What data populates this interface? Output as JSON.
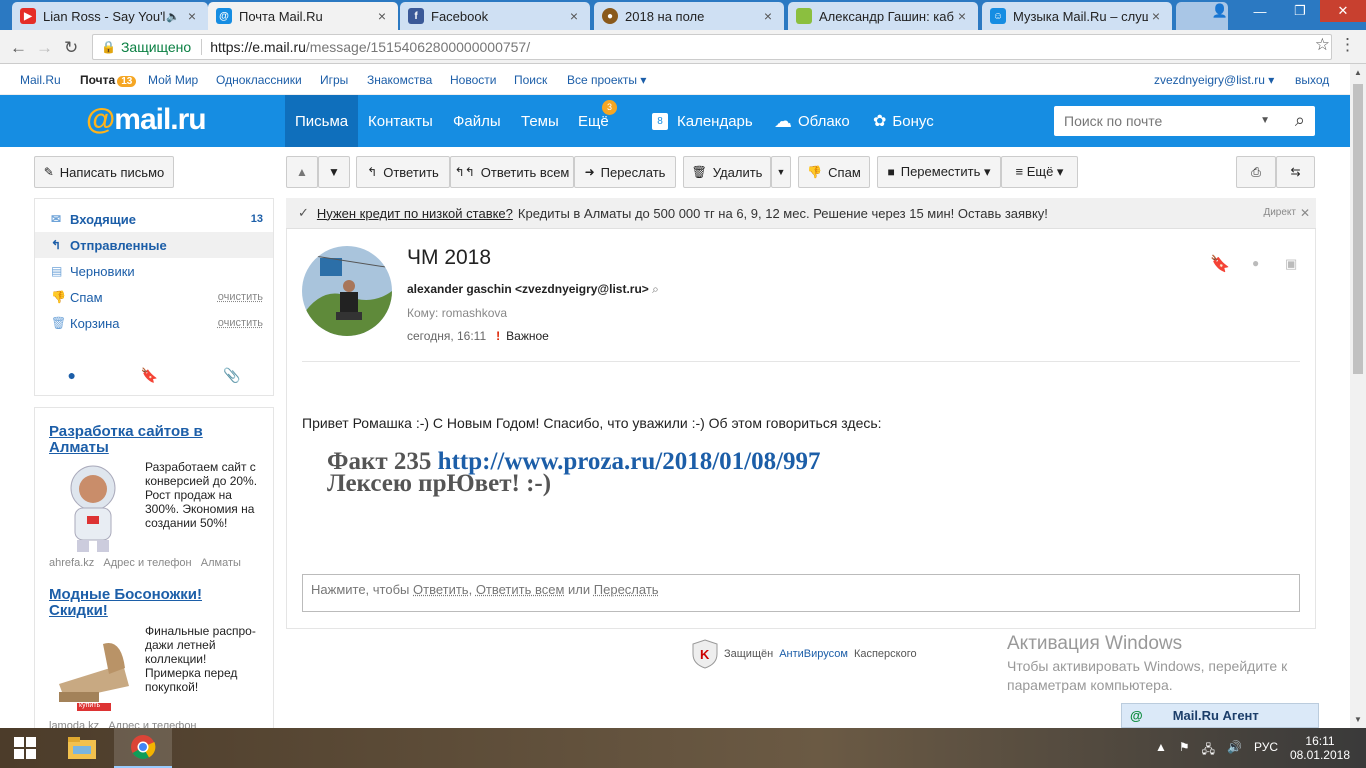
{
  "browser": {
    "tabs": [
      {
        "title": "Lian Ross - Say You'll",
        "color": "#e52d27",
        "icon": "youtube-icon"
      },
      {
        "title": "Почта Mail.Ru",
        "color": "#168de2",
        "icon": "mailru-icon"
      },
      {
        "title": "Facebook",
        "color": "#3b5998",
        "icon": "facebook-icon"
      },
      {
        "title": "2018 на поле",
        "color": "#8a5a1c",
        "icon": "ball-icon"
      },
      {
        "title": "Александр Гашин: каби",
        "color": "#8bbf3f",
        "icon": "page-icon"
      },
      {
        "title": "Музыка Mail.Ru – слуша",
        "color": "#168de2",
        "icon": "music-icon"
      }
    ],
    "secure_label": "Защищено",
    "url_host": "https://e.mail.ru",
    "url_path": "/message/15154062800000000757/"
  },
  "portal": {
    "links": [
      "Mail.Ru",
      "Почта",
      "Мой Мир",
      "Одноклассники",
      "Игры",
      "Знакомства",
      "Новости",
      "Поиск",
      "Все проекты ▾"
    ],
    "mail_count": "13",
    "user": "zvezdnyeigry@list.ru ▾",
    "logout": "выход"
  },
  "header": {
    "logo_at": "@",
    "logo_text": "mail.ru",
    "nav": [
      "Письма",
      "Контакты",
      "Файлы",
      "Темы",
      "Ещё"
    ],
    "more_badge": "3",
    "extra": [
      "Календарь",
      "Облако",
      "Бонус"
    ],
    "calendar_day": "8",
    "search_placeholder": "Поиск по почте"
  },
  "toolbar": {
    "compose": "Написать письмо",
    "reply": "Ответить",
    "reply_all": "Ответить всем",
    "forward": "Переслать",
    "delete": "Удалить",
    "spam": "Спам",
    "move": "Переместить ▾",
    "more": "≡ Ещё ▾"
  },
  "folders": [
    {
      "name": "Входящие",
      "count": "13",
      "clear": ""
    },
    {
      "name": "Отправленные",
      "count": "",
      "clear": ""
    },
    {
      "name": "Черновики",
      "count": "",
      "clear": ""
    },
    {
      "name": "Спам",
      "count": "",
      "clear": "очистить"
    },
    {
      "name": "Корзина",
      "count": "",
      "clear": "очистить"
    }
  ],
  "ads": [
    {
      "title": "Разработка сайтов в Алматы",
      "text": "Разработаем сайт с конверсией до 20%. Рост продаж на 300%. Экономия на создании 50%!",
      "meta1": "ahrefa.kz",
      "meta2": "Адрес и телефон",
      "meta3": "Алматы"
    },
    {
      "title": "Модные Босоножки! Скидки!",
      "text": "Финальные распро-дажи летней коллекции! Примерка перед покупкой!",
      "meta1": "lamoda.kz",
      "meta2": "Адрес и телефон",
      "meta3": "",
      "button": "купить"
    }
  ],
  "direct": {
    "link": "Нужен кредит по низкой ставке?",
    "text": "Кредиты в Алматы до 500 000 тг на 6, 9, 12 мес. Решение через 15 мин! Оставь заявку!",
    "label": "Директ"
  },
  "message": {
    "subject": "ЧМ 2018",
    "from": "alexander gaschin <zvezdnyeigry@list.ru>",
    "to": "Кому: romashkova",
    "date": "сегодня, 16:11",
    "important": "Важное",
    "body": "Привет Ромашка :-) С Новым Годом! Спасибо, что уважили :-) Об этом говориться здесь:",
    "fact": "Факт 235 ",
    "link": "http://www.proza.ru/2018/01/08/997",
    "line2": "Лексею прЮвет! :-)"
  },
  "reply_box": {
    "prefix": "Нажмите, чтобы ",
    "reply": "Ответить",
    "comma": ", ",
    "reply_all": "Ответить всем",
    "or": " или ",
    "forward": "Переслать"
  },
  "kaspersky": {
    "prefix": "Защищён",
    "link": "АнтиВирусом",
    "suffix": "Касперского"
  },
  "activation": {
    "title": "Активация Windows",
    "line1": "Чтобы активировать Windows, перейдите к",
    "line2": "параметрам компьютера."
  },
  "agent": "Mail.Ru Агент",
  "taskbar": {
    "lang": "РУС",
    "time": "16:11",
    "date": "08.01.2018"
  }
}
